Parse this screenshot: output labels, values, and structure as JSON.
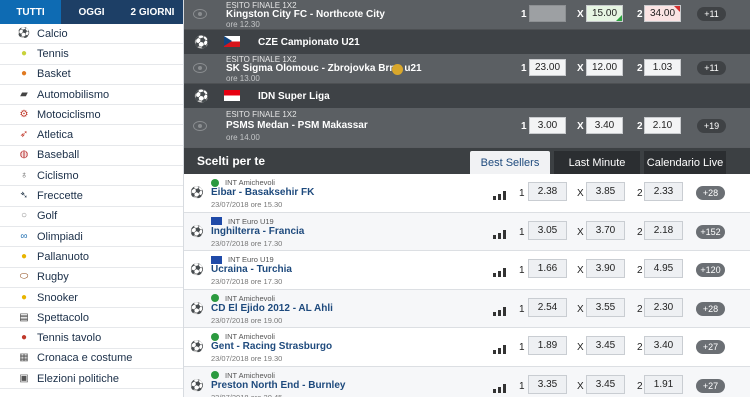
{
  "sidebar": {
    "tabs": [
      {
        "label": "TUTTI",
        "active": true
      },
      {
        "label": "OGGI",
        "active": false
      },
      {
        "label": "2 GIORNI",
        "active": false
      }
    ],
    "sports": [
      {
        "label": "Calcio",
        "icon": "soccer-ball-icon"
      },
      {
        "label": "Tennis",
        "icon": "tennis-ball-icon"
      },
      {
        "label": "Basket",
        "icon": "basketball-icon"
      },
      {
        "label": "Automobilismo",
        "icon": "race-car-icon"
      },
      {
        "label": "Motociclismo",
        "icon": "motorcycle-icon"
      },
      {
        "label": "Atletica",
        "icon": "runner-icon"
      },
      {
        "label": "Baseball",
        "icon": "baseball-icon"
      },
      {
        "label": "Ciclismo",
        "icon": "bicycle-icon"
      },
      {
        "label": "Freccette",
        "icon": "darts-icon"
      },
      {
        "label": "Golf",
        "icon": "golf-ball-icon"
      },
      {
        "label": "Olimpiadi",
        "icon": "olympic-rings-icon"
      },
      {
        "label": "Pallanuoto",
        "icon": "water-polo-ball-icon"
      },
      {
        "label": "Rugby",
        "icon": "rugby-ball-icon"
      },
      {
        "label": "Snooker",
        "icon": "snooker-ball-icon"
      },
      {
        "label": "Spettacolo",
        "icon": "clapperboard-icon"
      },
      {
        "label": "Tennis tavolo",
        "icon": "table-tennis-icon"
      },
      {
        "label": "Cronaca e costume",
        "icon": "newspaper-icon"
      },
      {
        "label": "Elezioni politiche",
        "icon": "ballot-icon"
      }
    ]
  },
  "events": {
    "rows": [
      {
        "market": "ESITO FINALE 1X2",
        "name": "Kingston City FC - Northcote City",
        "time": "ore 12.30",
        "odds": {
          "l1": "1",
          "o1": "",
          "lx": "X",
          "ox": "15.00",
          "l2": "2",
          "o2": "34.00"
        },
        "more": "+11"
      },
      {
        "league": "CZE Campionato U21"
      },
      {
        "market": "ESITO FINALE 1X2",
        "name": "SK Sigma Olomouc - Zbrojovka Brno u21",
        "time": "ore 13.00",
        "odds": {
          "l1": "1",
          "o1": "23.00",
          "lx": "X",
          "ox": "12.00",
          "l2": "2",
          "o2": "1.03"
        },
        "more": "+11"
      },
      {
        "league": "IDN Super Liga"
      },
      {
        "market": "ESITO FINALE 1X2",
        "name": "PSMS Medan - PSM Makassar",
        "time": "ore 14.00",
        "odds": {
          "l1": "1",
          "o1": "3.00",
          "lx": "X",
          "ox": "3.40",
          "l2": "2",
          "o2": "2.10"
        },
        "more": "+19"
      }
    ]
  },
  "picks": {
    "title": "Scelti per te",
    "tabs": [
      {
        "label": "Best Sellers",
        "active": true
      },
      {
        "label": "Last Minute",
        "active": false
      },
      {
        "label": "Calendario Live",
        "active": false
      }
    ],
    "rows": [
      {
        "competition": "INT Amichevoli",
        "flag": "intl",
        "name": "Eibar - Basaksehir FK",
        "date": "23/07/2018 ore 15.30",
        "o1": "2.38",
        "ox": "3.85",
        "o2": "2.33",
        "more": "+28"
      },
      {
        "competition": "INT Euro U19",
        "flag": "eu",
        "name": "Inghilterra - Francia",
        "date": "23/07/2018 ore 17.30",
        "o1": "3.05",
        "ox": "3.70",
        "o2": "2.18",
        "more": "+152"
      },
      {
        "competition": "INT Euro U19",
        "flag": "eu",
        "name": "Ucraina - Turchia",
        "date": "23/07/2018 ore 17.30",
        "o1": "1.66",
        "ox": "3.90",
        "o2": "4.95",
        "more": "+120"
      },
      {
        "competition": "INT Amichevoli",
        "flag": "intl",
        "name": "CD El Ejido 2012 - AL Ahli",
        "date": "23/07/2018 ore 19.00",
        "o1": "2.54",
        "ox": "3.55",
        "o2": "2.30",
        "more": "+28"
      },
      {
        "competition": "INT Amichevoli",
        "flag": "intl",
        "name": "Gent - Racing Strasburgo",
        "date": "23/07/2018 ore 19.30",
        "o1": "1.89",
        "ox": "3.45",
        "o2": "3.40",
        "more": "+27"
      },
      {
        "competition": "INT Amichevoli",
        "flag": "intl",
        "name": "Preston North End - Burnley",
        "date": "23/07/2018 ore 20.45",
        "o1": "3.35",
        "ox": "3.45",
        "o2": "1.91",
        "more": "+27"
      }
    ],
    "labels": {
      "l1": "1",
      "lx": "X",
      "l2": "2"
    }
  }
}
